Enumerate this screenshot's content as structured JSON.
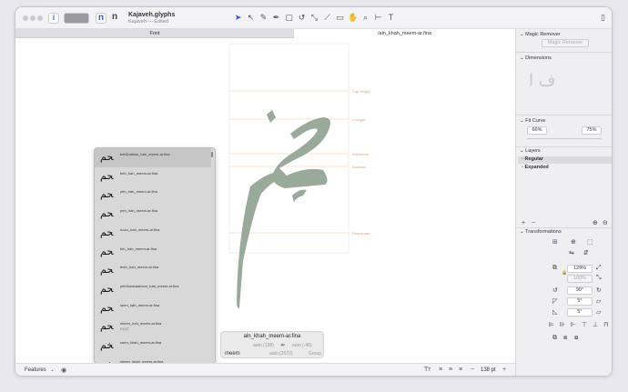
{
  "window": {
    "title": "Kajaveh.glyphs",
    "subtitle": "Kajaveh — Edited"
  },
  "toolbar": {
    "view_info": "i",
    "glyph_n1": "n",
    "glyph_n2": "n",
    "tools": [
      "pointer-tool",
      "select-tool",
      "draw-tool",
      "pen-tool",
      "primitives-tool",
      "rotate-tool",
      "scale-tool",
      "knife-tool",
      "annotation-tool",
      "hand-tool",
      "zoom-tool",
      "measure-tool",
      "text-tool"
    ],
    "sidebar_toggle": "sidebar-toggle"
  },
  "tabs": [
    {
      "label": "Font",
      "active": false
    },
    {
      "label": "/ain_khah_meem-ar.fina",
      "active": true
    }
  ],
  "canvas": {
    "metric_labels": [
      "Cap Height",
      "x-height",
      "Kasheeda",
      "Baseline",
      "Descender"
    ],
    "glyph_fill": "#9aaa9a"
  },
  "popup": {
    "items": [
      {
        "glyph": "ﺤﻢ",
        "name": "behDotless_hah_meem-ar.fina",
        "sub": ""
      },
      {
        "glyph": "ﺤﻢ",
        "name": "beh_hah_meem-ar.fina",
        "sub": ""
      },
      {
        "glyph": "ﺤﻢ",
        "name": "yeh_hah_meem-ar.fina",
        "sub": ""
      },
      {
        "glyph": "ﺤﻢ",
        "name": "peh_hah_meem-ar.fina",
        "sub": ""
      },
      {
        "glyph": "ﺤﻢ",
        "name": "noon_hah_meem-ar.fina",
        "sub": ""
      },
      {
        "glyph": "ﺤﻢ",
        "name": "teh_hah_meem-ar.fina",
        "sub": ""
      },
      {
        "glyph": "ﺤﻢ",
        "name": "theh_hah_meem-ar.fina",
        "sub": ""
      },
      {
        "glyph": "ﺤﻢ",
        "name": "yehHamzaabove_hah_meem-ar.fina",
        "sub": ""
      },
      {
        "glyph": "ﺤﻢ",
        "name": "seen_hah_meem-ar.fina",
        "sub": ""
      },
      {
        "glyph": "ﺤﻢ",
        "name": "sheen_hah_meem-ar.fina",
        "sub": "FEAT"
      },
      {
        "glyph": "ﺨﻢ",
        "name": "seen_khah_meem-ar.fina",
        "sub": ""
      },
      {
        "glyph": "ﺨﻢ",
        "name": "sheen_khah_meem-ar.fina",
        "sub": ""
      }
    ]
  },
  "infobox": {
    "glyph_name": "ain_khah_meem-ar.fina",
    "lsb": "auto (198)",
    "rsb": "auto (-46)",
    "width": "auto (2072)",
    "char": "meem",
    "group": "Group"
  },
  "bottombar": {
    "features_label": "Features",
    "zoom_minus": "−",
    "zoom_value": "138 pt",
    "zoom_plus": "+"
  },
  "panel": {
    "magic_remover_title": "Magic Remover",
    "magic_remover_button": "Magic Remover",
    "dimensions_title": "Dimensions",
    "fit_curve_title": "Fit Curve",
    "fit_curve_min": "66%",
    "fit_curve_max": "75%",
    "layers_title": "Layers",
    "layers": [
      {
        "name": "Regular",
        "selected": true
      },
      {
        "name": "Expanded",
        "selected": false
      }
    ],
    "transformations_title": "Transformations",
    "scale_value": "129%",
    "scale_value_2": "100%",
    "rotate_value": "90°",
    "slant_value_1": "5°",
    "slant_value_2": "5°"
  }
}
